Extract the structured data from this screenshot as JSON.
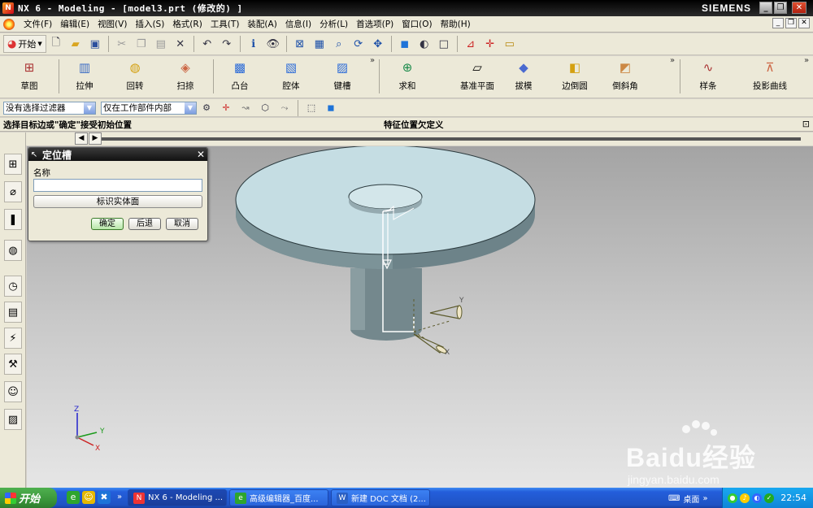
{
  "window": {
    "title": "NX 6 - Modeling - [model3.prt  (修改的) ]",
    "brand": "SIEMENS"
  },
  "menu": [
    "文件(F)",
    "编辑(E)",
    "视图(V)",
    "插入(S)",
    "格式(R)",
    "工具(T)",
    "装配(A)",
    "信息(I)",
    "分析(L)",
    "首选项(P)",
    "窗口(O)",
    "帮助(H)"
  ],
  "standard_toolbar": {
    "start_label": "开始",
    "icons": [
      "new-file-icon",
      "open-folder-icon",
      "save-icon",
      "cut-icon",
      "copy-icon",
      "paste-icon",
      "delete-icon",
      "undo-icon",
      "redo-icon",
      "information-icon",
      "view-options-icon",
      "fit-view-icon",
      "zoom-window-icon",
      "zoom-icon",
      "rotate-icon",
      "pan-icon",
      "shaded-view-icon",
      "render-style-icon",
      "background-icon",
      "wcs-icon",
      "snap-point-icon",
      "measure-icon"
    ]
  },
  "feature_toolbar": {
    "buttons": [
      {
        "label": "草图",
        "icon": "sketch-icon"
      },
      {
        "label": "拉伸",
        "icon": "extrude-icon"
      },
      {
        "label": "回转",
        "icon": "revolve-icon"
      },
      {
        "label": "扫掠",
        "icon": "sweep-icon"
      },
      {
        "label": "凸台",
        "icon": "boss-icon"
      },
      {
        "label": "腔体",
        "icon": "pocket-icon"
      },
      {
        "label": "键槽",
        "icon": "slot-icon"
      },
      {
        "label": "求和",
        "icon": "unite-icon"
      },
      {
        "label": "基准平面",
        "icon": "datum-plane-icon"
      },
      {
        "label": "拔模",
        "icon": "draft-icon"
      },
      {
        "label": "边倒圆",
        "icon": "edge-blend-icon"
      },
      {
        "label": "倒斜角",
        "icon": "chamfer-icon"
      },
      {
        "label": "样条",
        "icon": "spline-icon"
      },
      {
        "label": "投影曲线",
        "icon": "project-curve-icon"
      }
    ]
  },
  "selection_bar": {
    "filter": "没有选择过滤器",
    "scope": "仅在工作部件内部"
  },
  "cue_line": {
    "cue": "选择目标边或\"确定\"接受初始位置",
    "status": "特征位置欠定义"
  },
  "dialog": {
    "title": "定位槽",
    "name_label": "名称",
    "name_value": "",
    "identify_face_button": "标识实体面",
    "ok": "确定",
    "back": "后退",
    "cancel": "取消"
  },
  "triad": {
    "x": "X",
    "y": "Y",
    "z": "Z"
  },
  "watermark": {
    "text": "Baidu经验",
    "url": "jingyan.baidu.com"
  },
  "taskbar": {
    "start": "开始",
    "tasks": [
      {
        "label": "NX 6 - Modeling ...",
        "active": true
      },
      {
        "label": "高级编辑器_百度...",
        "active": false
      },
      {
        "label": "新建 DOC 文档 (2...",
        "active": false
      }
    ],
    "desktop": "桌面",
    "clock": "22:54"
  },
  "colors": {
    "disk_top": "#c5dde3",
    "disk_side": "#6d8389",
    "shaft": "#74888d",
    "viewport_top": "#a4a4a4",
    "viewport_bottom": "#e6e6e6"
  }
}
